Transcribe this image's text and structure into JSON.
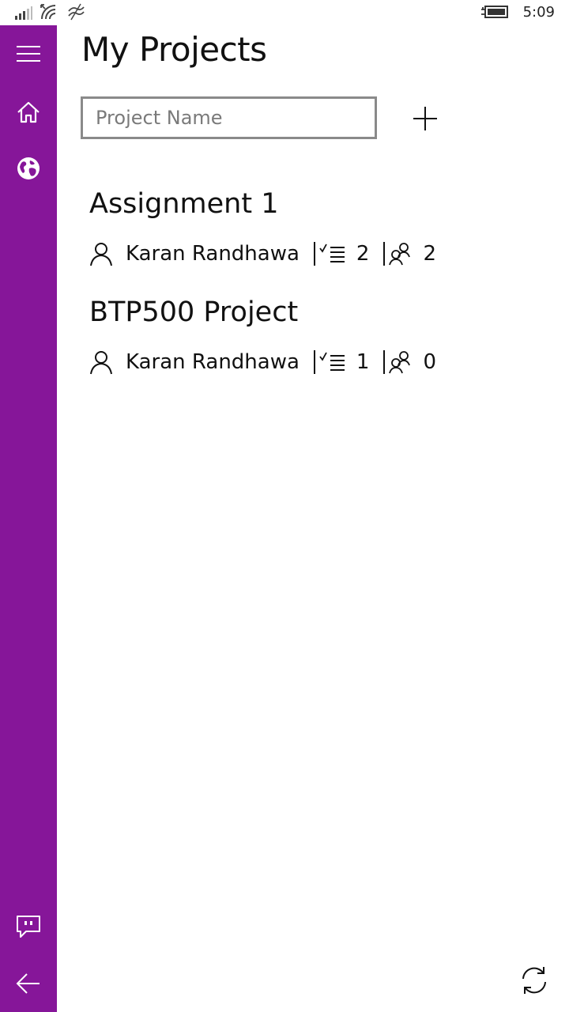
{
  "status_bar": {
    "time": "5:09",
    "icons": [
      "signal-icon",
      "wifi-icon",
      "data-saver-icon",
      "battery-charging-icon"
    ]
  },
  "sidebar": {
    "items": [
      {
        "name": "hamburger-menu",
        "icon": "hamburger-icon"
      },
      {
        "name": "home",
        "icon": "home-icon"
      },
      {
        "name": "globe",
        "icon": "globe-icon"
      },
      {
        "name": "feedback",
        "icon": "feedback-icon"
      },
      {
        "name": "back",
        "icon": "back-arrow-icon"
      }
    ],
    "color": "#861699"
  },
  "main": {
    "title": "My Projects",
    "project_name_input": {
      "placeholder": "Project Name",
      "value": ""
    },
    "add_button_icon": "plus-icon",
    "refresh_button_icon": "refresh-icon"
  },
  "projects": [
    {
      "name": "Assignment 1",
      "owner": "Karan Randhawa",
      "tasks": "2",
      "members": "2"
    },
    {
      "name": "BTP500 Project",
      "owner": "Karan Randhawa",
      "tasks": "1",
      "members": "0"
    }
  ]
}
